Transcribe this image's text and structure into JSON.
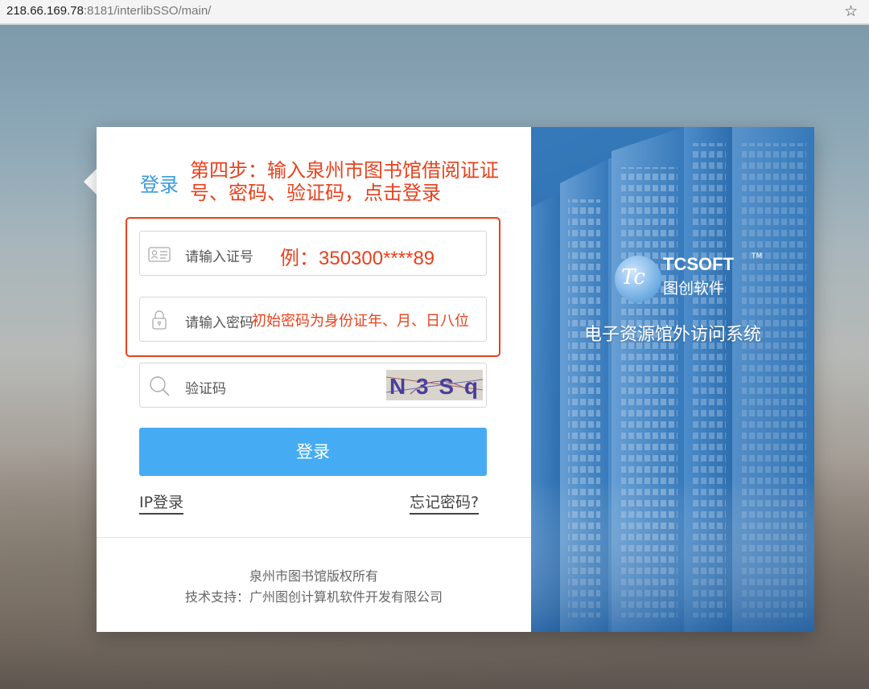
{
  "browser": {
    "url_host": "218.66.169.78",
    "url_rest": ":8181/interlibSSO/main/",
    "bookmark_icon": "star-icon"
  },
  "login": {
    "title": "登录",
    "step_note": "第四步：输入泉州市图书馆借阅证证号、密码、验证码，点击登录",
    "card_number_placeholder": "请输入证号",
    "card_number_hint": "例：350300****89",
    "password_placeholder": "请输入密码",
    "password_hint": "初始密码为身份证年、月、日八位",
    "captcha_placeholder": "验证码",
    "captcha_text": "N3Sq",
    "submit_label": "登录",
    "ip_login_label": "IP登录",
    "forgot_password_label": "忘记密码?",
    "icons": {
      "card": "id-card-icon",
      "password": "lock-icon",
      "captcha": "search-icon"
    }
  },
  "footer": {
    "copyright": "泉州市图书馆版权所有",
    "support": "技术支持：广州图创计算机软件开发有限公司"
  },
  "promo": {
    "logo_mark": "Tc",
    "brand": "TCSOFT",
    "trademark": "TM",
    "brand_cn": "图创软件",
    "system_name": "电子资源馆外访问系统"
  },
  "colors": {
    "accent_blue": "#45acf3",
    "title_blue": "#3a9ae0",
    "annotation_red": "#e8411c",
    "promo_blue": "#2f73b6"
  }
}
